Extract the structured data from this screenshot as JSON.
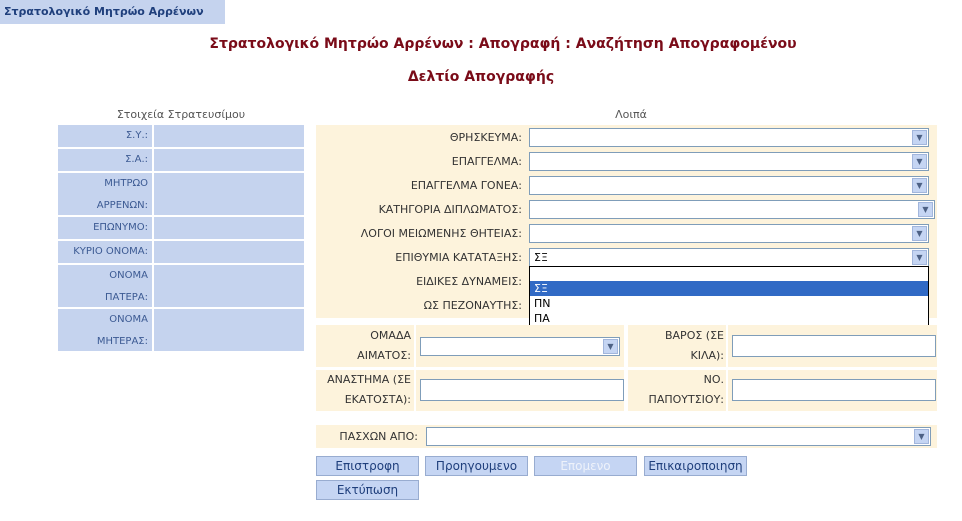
{
  "app_tab": "Στρατολογικό Μητρώο Αρρένων",
  "header": {
    "title": "Στρατολογικό Μητρώο Αρρένων : Απογραφή : Αναζήτηση Απογραφομένου",
    "subtitle": "Δελτίο Απογραφής"
  },
  "left": {
    "title": "Στοιχεία Στρατευσίμου",
    "rows": [
      {
        "label": "Σ.Υ.:"
      },
      {
        "label": "Σ.Α.:"
      },
      {
        "label1": "ΜΗΤΡΩΟ",
        "label2": "ΑΡΡΕΝΩΝ:"
      },
      {
        "label": "ΕΠΩΝΥΜΟ:"
      },
      {
        "label": "ΚΥΡΙΟ ΟΝΟΜΑ:"
      },
      {
        "label1": "ΟΝΟΜΑ",
        "label2": "ΠΑΤΕΡΑ:"
      },
      {
        "label1": "ΟΝΟΜΑ",
        "label2": "ΜΗΤΕΡΑΣ:"
      }
    ]
  },
  "right": {
    "title": "Λοιπά",
    "fields": [
      {
        "label": "ΘΡΗΣΚΕΥΜΑ:",
        "value": ""
      },
      {
        "label": "ΕΠΑΓΓΕΛΜΑ:",
        "value": ""
      },
      {
        "label": "ΕΠΑΓΓΕΛΜΑ ΓΟΝΕΑ:",
        "value": ""
      },
      {
        "label": "ΚΑΤΗΓΟΡΙΑ ΔΙΠΛΩΜΑΤΟΣ:",
        "value": ""
      },
      {
        "label": "ΛΟΓΟΙ ΜΕΙΩΜΕΝΗΣ ΘΗΤΕΙΑΣ:",
        "value": ""
      },
      {
        "label": "ΕΠΙΘΥΜΙΑ ΚΑΤΑΤΑΞΗΣ:",
        "value": "ΣΞ"
      },
      {
        "label": "ΕΙΔΙΚΕΣ ΔΥΝΑΜΕΙΣ:"
      },
      {
        "label": "ΩΣ ΠΕΖΟΝΑΥΤΗΣ:"
      }
    ],
    "dropdown_options": [
      "",
      "ΣΞ",
      "ΠΝ",
      "ΠΑ"
    ],
    "blood_label1": "ΟΜΑΔΑ",
    "blood_label2": "ΑΙΜΑΤΟΣ:",
    "weight_label1": "ΒΑΡΟΣ (ΣΕ",
    "weight_label2": "ΚΙΛΑ):",
    "height_label1": "ΑΝΑΣΤΗΜΑ (ΣΕ",
    "height_label2": "ΕΚΑΤΟΣΤΑ):",
    "shoe_label1": "ΝΟ.",
    "shoe_label2": "ΠΑΠΟΥΤΣΙΟΥ:",
    "suffers_label": "ΠΑΣΧΩΝ ΑΠΟ:"
  },
  "buttons": {
    "back": "Επιστροφη",
    "prev": "Προηγουμενο",
    "next": "Επομενο",
    "refresh": "Επικαιροποιηση",
    "print": "Εκτύπωση"
  }
}
